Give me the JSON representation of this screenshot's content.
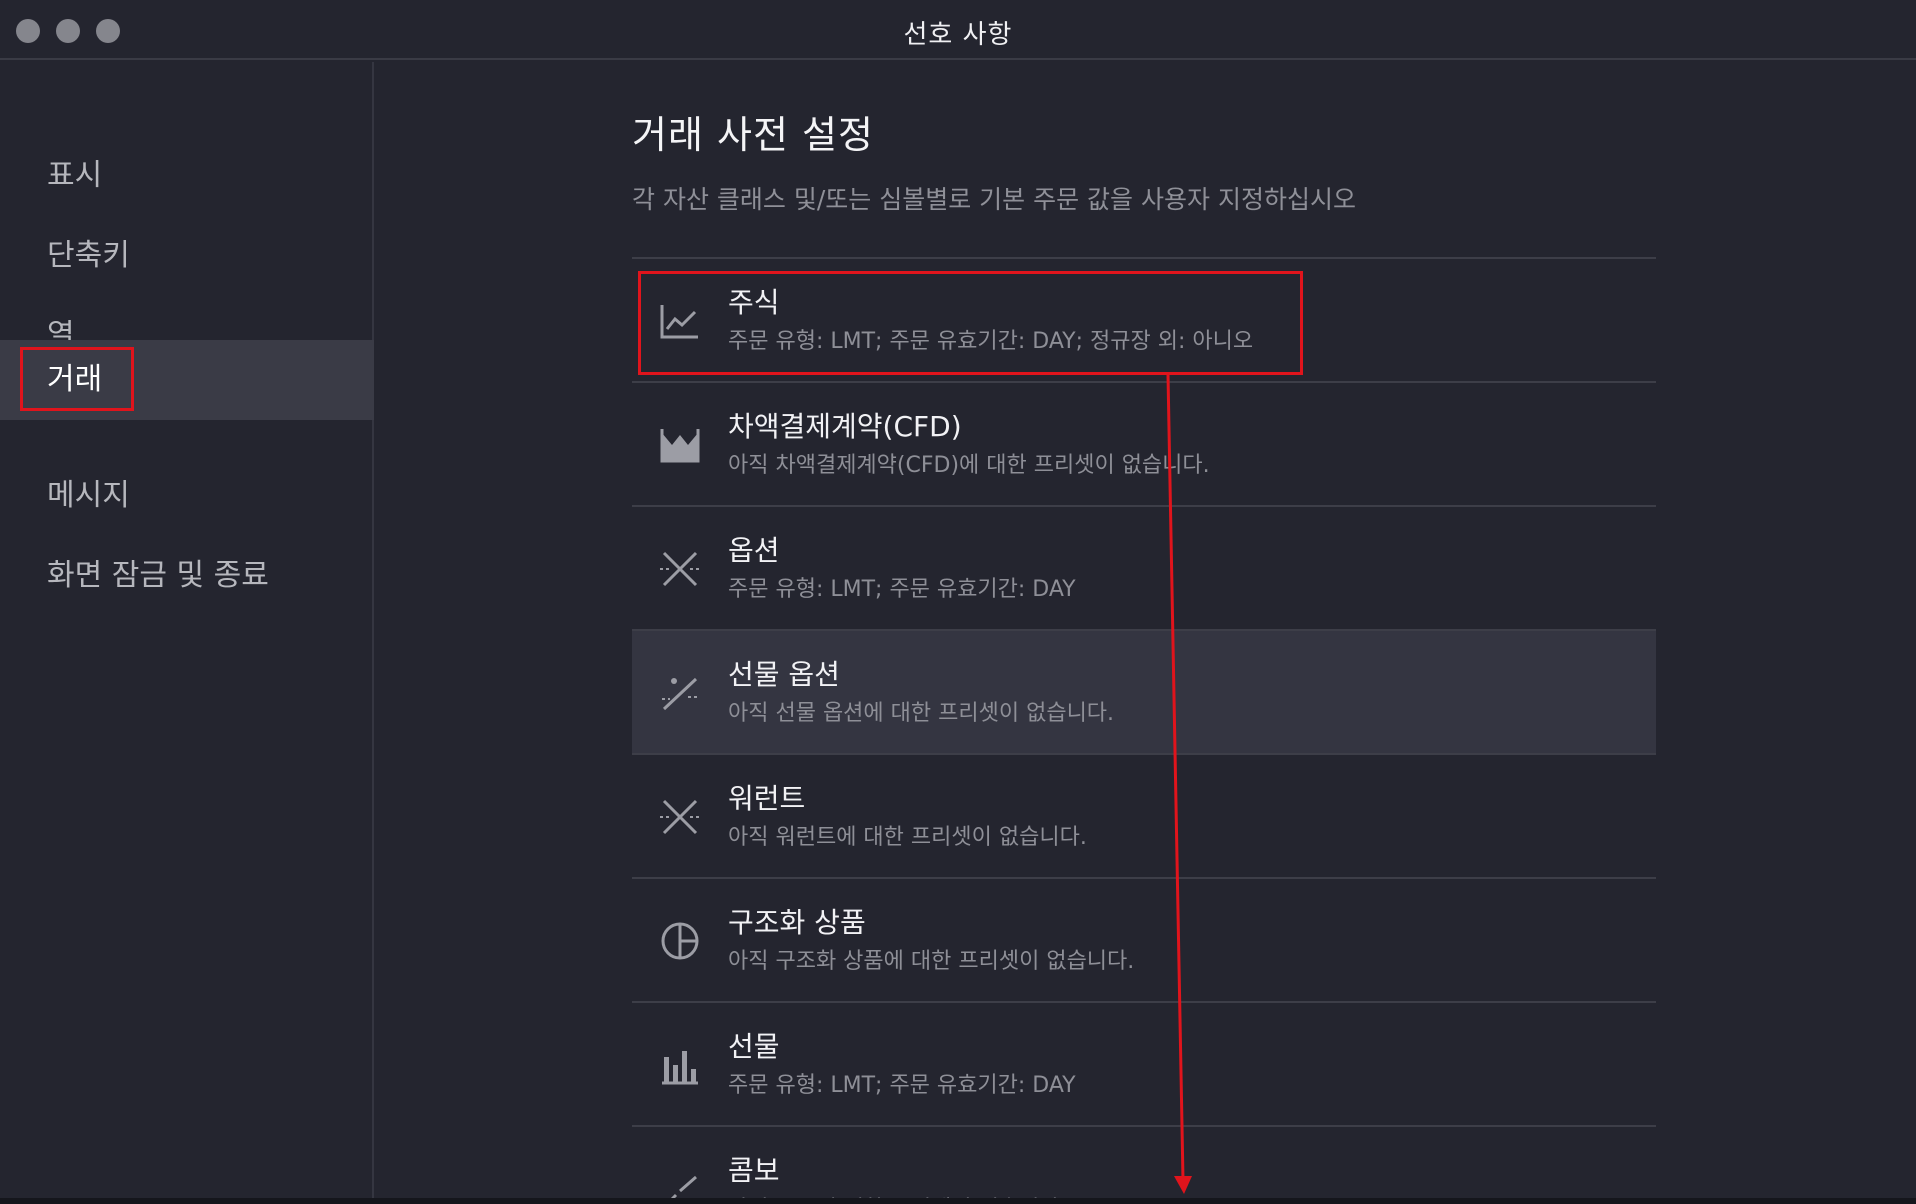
{
  "window": {
    "title": "선호 사항"
  },
  "sidebar": {
    "items": [
      {
        "label": "표시",
        "active": false
      },
      {
        "label": "단축키",
        "active": false
      },
      {
        "label": "열",
        "active": false
      },
      {
        "label": "거래",
        "active": true
      },
      {
        "label": "메시지",
        "active": false
      },
      {
        "label": "화면 잠금 및 종료",
        "active": false
      }
    ]
  },
  "main": {
    "heading": "거래 사전 설정",
    "subheading": "각 자산 클래스 및/또는 심볼별로 기본 주문 값을 사용자 지정하십시오",
    "rows": [
      {
        "title": "주식",
        "desc": "주문 유형: LMT; 주문 유효기간: DAY; 정규장 외: 아니오",
        "icon": "line-chart-icon"
      },
      {
        "title": "차액결제계약(CFD)",
        "desc": "아직 차액결제계약(CFD)에 대한 프리셋이 없습니다.",
        "icon": "crown-chart-icon"
      },
      {
        "title": "옵션",
        "desc": "주문 유형: LMT; 주문 유효기간: DAY",
        "icon": "options-cross-icon"
      },
      {
        "title": "선물 옵션",
        "desc": "아직 선물 옵션에 대한 프리셋이 없습니다.",
        "icon": "futures-options-icon"
      },
      {
        "title": "워런트",
        "desc": "아직 워런트에 대한 프리셋이 없습니다.",
        "icon": "warrant-cross-icon"
      },
      {
        "title": "구조화 상품",
        "desc": "아직 구조화 상품에 대한 프리셋이 없습니다.",
        "icon": "pie-chart-icon"
      },
      {
        "title": "선물",
        "desc": "주문 유형: LMT; 주문 유효기간: DAY",
        "icon": "bar-chart-icon"
      },
      {
        "title": "콤보",
        "desc": "아직 콤보에 대한 프리셋이 없습니다.",
        "icon": "combo-icon"
      }
    ]
  },
  "colors": {
    "background": "#24252f",
    "active": "#3a3b46",
    "highlight": "#e0141c",
    "muted_text": "#8e8f97"
  }
}
